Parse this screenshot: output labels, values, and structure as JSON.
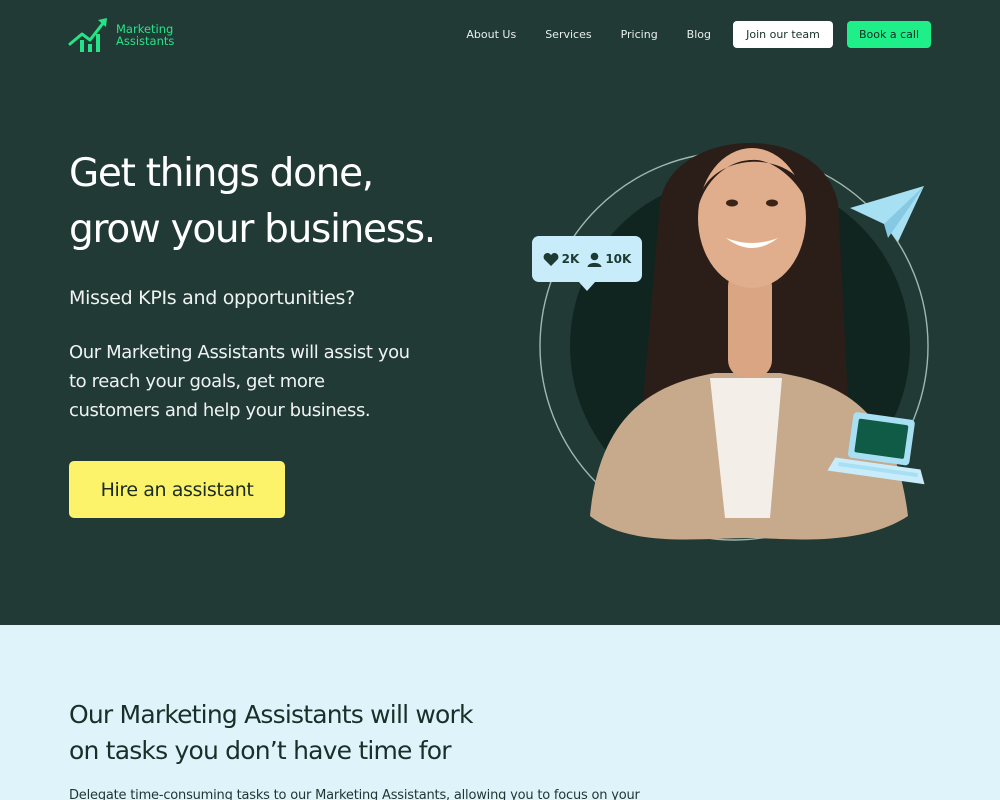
{
  "header": {
    "logo_line1": "Marketing",
    "logo_line2": "Assistants",
    "nav": [
      "About Us",
      "Services",
      "Pricing",
      "Blog"
    ],
    "join_label": "Join our team",
    "book_label": "Book a call"
  },
  "hero": {
    "title_line1": "Get things done,",
    "title_line2": "grow your business.",
    "subtitle": "Missed KPIs and opportunities?",
    "body_line1": "Our Marketing Assistants will assist you",
    "body_line2": "to reach your goals, get more",
    "body_line3": "customers and help your business.",
    "cta_label": "Hire an assistant",
    "stats": {
      "likes": "2K",
      "followers": "10K"
    }
  },
  "section": {
    "title_line1": "Our Marketing Assistants will work",
    "title_line2": "on tasks you don’t have time for",
    "body": "Delegate time-consuming tasks to our Marketing Assistants, allowing you to focus on your"
  },
  "colors": {
    "hero_bg": "#213a35",
    "brand_green": "#1eef88",
    "cta_yellow": "#fdf36b",
    "section_bg": "#dff3fb",
    "accent_blue": "#a7dff3"
  },
  "icons": [
    "logo-chart-icon",
    "heart-icon",
    "user-icon",
    "paper-plane-icon",
    "laptop-icon"
  ]
}
